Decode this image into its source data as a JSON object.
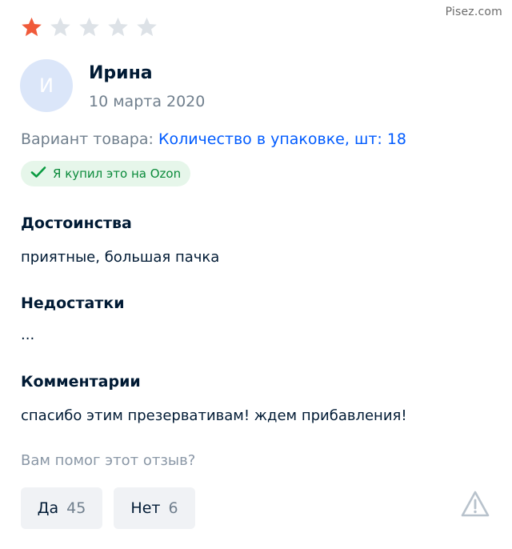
{
  "watermark": "Pisez.com",
  "rating": {
    "value": 1,
    "max": 5,
    "filled_color": "#f05a3a",
    "empty_color": "#dde2e7"
  },
  "author": {
    "initial": "И",
    "name": "Ирина",
    "date": "10 марта 2020"
  },
  "variant": {
    "label": "Вариант товара:",
    "value": "Количество в упаковке, шт: 18"
  },
  "badge": {
    "icon": "check-icon",
    "text": "Я купил это на Ozon"
  },
  "sections": {
    "pros": {
      "title": "Достоинства",
      "text": "приятные, большая пачка"
    },
    "cons": {
      "title": "Недостатки",
      "text": "..."
    },
    "comment": {
      "title": "Комментарии",
      "text": "спасибо этим презервативам! ждем прибавления!"
    }
  },
  "helpful": {
    "question": "Вам помог этот отзыв?",
    "yes": {
      "label": "Да",
      "count": "45"
    },
    "no": {
      "label": "Нет",
      "count": "6"
    },
    "report_icon": "warning-icon"
  }
}
